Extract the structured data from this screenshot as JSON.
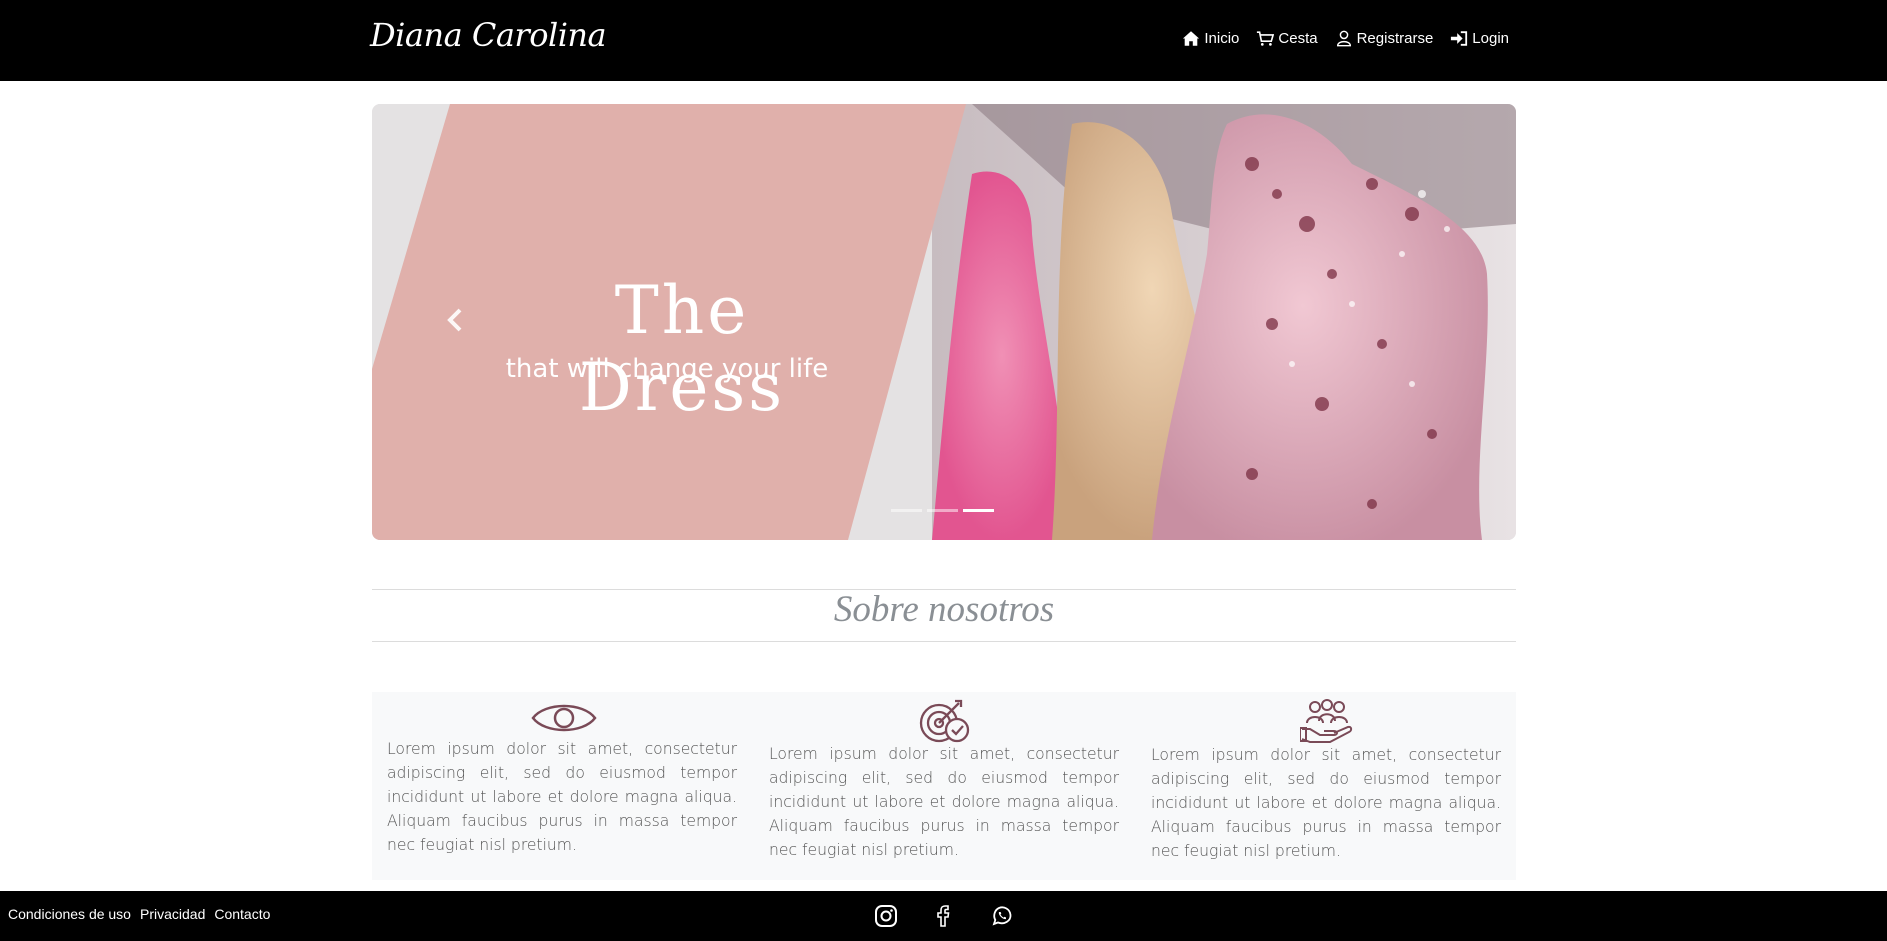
{
  "navbar": {
    "brand": "Diana Carolina",
    "links": [
      {
        "label": "Inicio",
        "icon": "home-icon"
      },
      {
        "label": "Cesta",
        "icon": "cart-icon"
      },
      {
        "label": "Registrarse",
        "icon": "user-icon"
      },
      {
        "label": "Login",
        "icon": "sign-in-icon"
      }
    ]
  },
  "carousel": {
    "title": "The Dress",
    "subtitle": "that will change your life",
    "indicators": 3,
    "active_index": 2
  },
  "about": {
    "title": "Sobre nosotros",
    "features": [
      {
        "icon": "eye-icon",
        "text": "Lorem ipsum dolor sit amet, consectetur adipiscing elit, sed do eiusmod tempor incididunt ut labore et dolore magna aliqua. Aliquam faucibus purus in massa tempor nec feugiat nisl pretium."
      },
      {
        "icon": "target-check-icon",
        "text": "Lorem ipsum dolor sit amet, consectetur adipiscing elit, sed do eiusmod tempor incididunt ut labore et dolore magna aliqua. Aliquam faucibus purus in massa tempor nec feugiat nisl pretium."
      },
      {
        "icon": "team-hand-icon",
        "text": "Lorem ipsum dolor sit amet, consectetur adipiscing elit, sed do eiusmod tempor incididunt ut labore et dolore magna aliqua. Aliquam faucibus purus in massa tempor nec feugiat nisl pretium."
      }
    ]
  },
  "footer": {
    "links": [
      "Condiciones de uso",
      "Privacidad",
      "Contacto"
    ],
    "social": [
      "instagram-icon",
      "facebook-icon",
      "whatsapp-icon"
    ]
  },
  "colors": {
    "navbar_bg": "#000000",
    "slide_panel": "#e0b0ab",
    "icon_color": "#7a4a57",
    "section_title": "#8a8f94",
    "features_bg": "#f8f9fa"
  }
}
